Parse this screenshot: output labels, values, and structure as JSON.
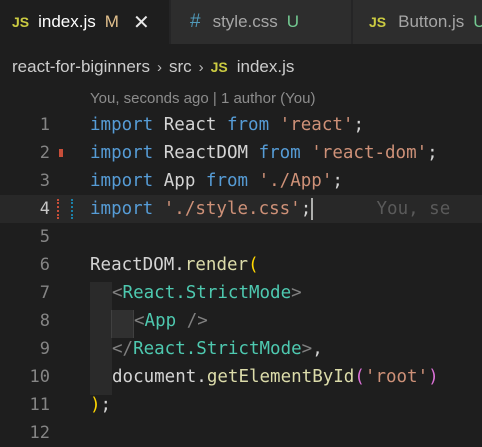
{
  "tabs": [
    {
      "icon": "JS",
      "name": "index.js",
      "status": "M",
      "close": "✕"
    },
    {
      "icon": "#",
      "name": "style.css",
      "status": "U"
    },
    {
      "icon": "JS",
      "name": "Button.js",
      "status": "U"
    }
  ],
  "breadcrumb": {
    "folder": "react-for-biginners",
    "sep": "›",
    "subfolder": "src",
    "file_icon": "JS",
    "file": "index.js"
  },
  "blame_header": "You, seconds ago | 1 author (You)",
  "line_numbers": [
    "1",
    "2",
    "3",
    "4",
    "5",
    "6",
    "7",
    "8",
    "9",
    "10",
    "11",
    "12"
  ],
  "code": {
    "l1": {
      "kw1": "import",
      "id": " React ",
      "kw2": "from",
      "str": " 'react'",
      "end": ";"
    },
    "l2": {
      "kw1": "import",
      "id": " ReactDOM ",
      "kw2": "from",
      "str": " 'react-dom'",
      "end": ";"
    },
    "l3": {
      "kw1": "import",
      "id": " App ",
      "kw2": "from",
      "str": " './App'",
      "end": ";"
    },
    "l4": {
      "kw1": "import",
      "str": " './style.css'",
      "end": ";",
      "ghost": "      You, se"
    },
    "l6": {
      "obj": "ReactDOM",
      "dot": ".",
      "fn": "render",
      "paren": "("
    },
    "l7": {
      "open": "<",
      "tag": "React.StrictMode",
      "close": ">"
    },
    "l8": {
      "open": "<",
      "tag": "App",
      "close": " />"
    },
    "l9": {
      "open": "</",
      "tag": "React.StrictMode",
      "close": ">",
      "comma": ","
    },
    "l10": {
      "obj": "document",
      "dot": ".",
      "fn": "getElementById",
      "p1": "(",
      "str": "'root'",
      "p2": ")"
    },
    "l11": {
      "paren": ")",
      "end": ";"
    }
  }
}
